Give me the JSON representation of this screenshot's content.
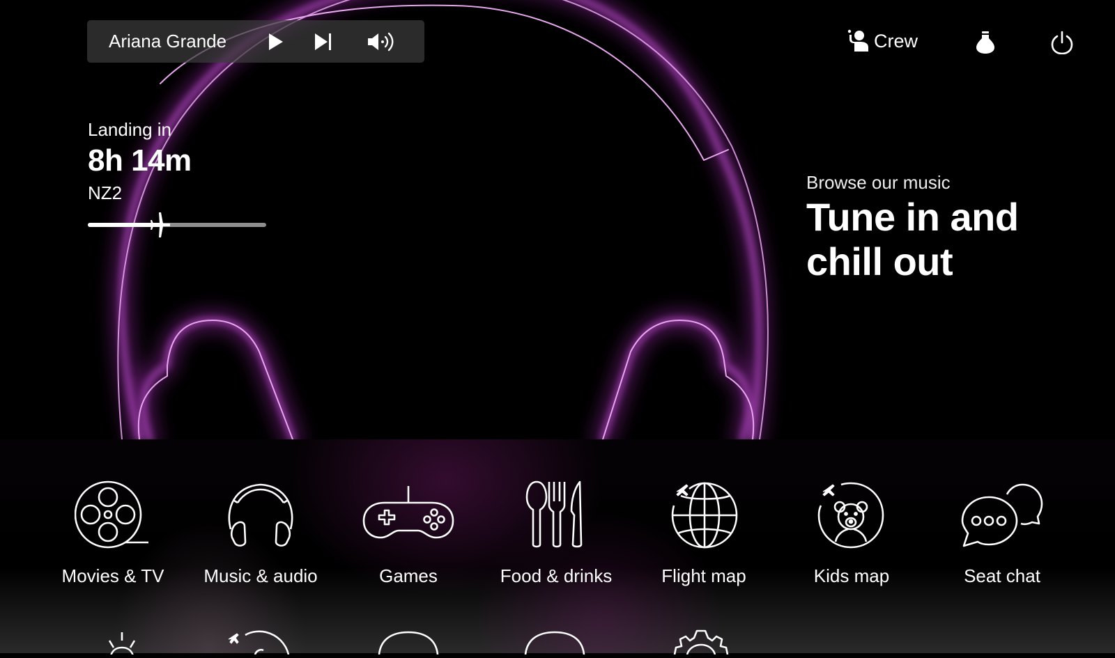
{
  "player": {
    "artist": "Ariana Grande",
    "controls": [
      {
        "name": "play",
        "icon": "play-icon"
      },
      {
        "name": "next",
        "icon": "skip-next-icon"
      },
      {
        "name": "volume",
        "icon": "volume-icon"
      }
    ]
  },
  "header": {
    "crew_label": "Crew",
    "crew_icon": "crew-call-icon",
    "light_icon": "reading-light-icon",
    "power_icon": "power-icon"
  },
  "flight": {
    "landing_label": "Landing in",
    "time_remaining": "8h 14m",
    "flight_number": "NZ2",
    "progress_fraction": 0.42
  },
  "promo": {
    "subtitle": "Browse our music",
    "headline_line1": "Tune in and",
    "headline_line2": "chill out"
  },
  "colors": {
    "neon": "#d070e0",
    "glow": "#9a2aa8",
    "player_bg": "#3c3c3c",
    "progress_track": "#8e8e8e"
  },
  "menu": {
    "items": [
      {
        "label": "Movies & TV",
        "icon": "film-reel-icon"
      },
      {
        "label": "Music & audio",
        "icon": "headphones-icon"
      },
      {
        "label": "Games",
        "icon": "gamepad-icon"
      },
      {
        "label": "Food & drinks",
        "icon": "cutlery-icon"
      },
      {
        "label": "Flight map",
        "icon": "globe-plane-icon"
      },
      {
        "label": "Kids map",
        "icon": "teddy-bear-plane-icon"
      },
      {
        "label": "Seat chat",
        "icon": "chat-bubbles-icon"
      }
    ],
    "row2_icons": [
      "light-icon",
      "plane-orbit-icon",
      "circle-icon",
      "circle-icon",
      "settings-gear-icon"
    ]
  }
}
